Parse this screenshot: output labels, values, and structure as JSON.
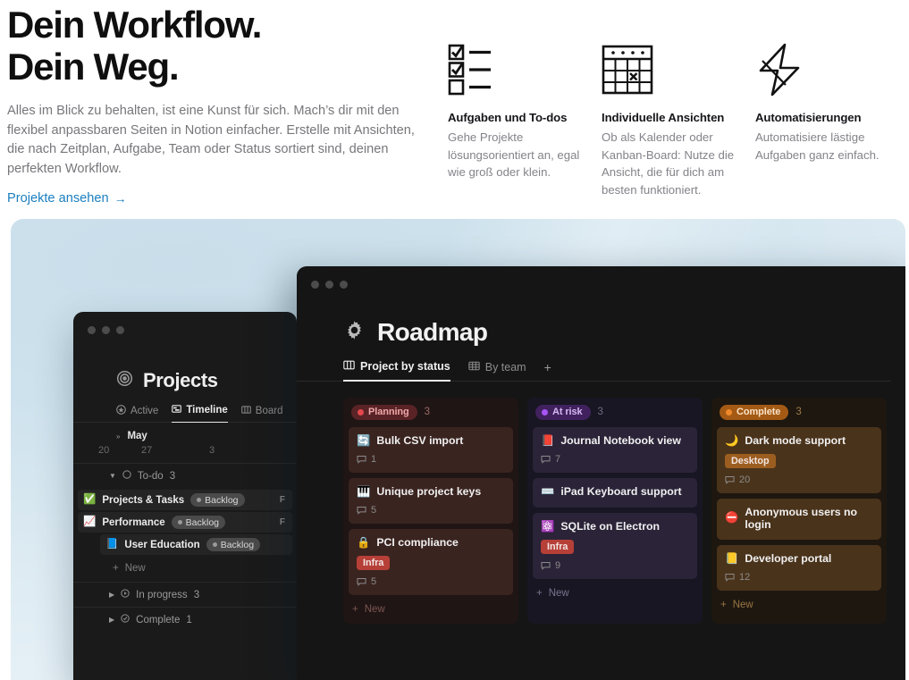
{
  "hero": {
    "title_line1": "Dein Workflow.",
    "title_line2": "Dein Weg.",
    "body": "Alles im Blick zu behalten, ist eine Kunst für sich. Mach’s dir mit den flexibel anpassbaren Seiten in Notion einfacher. Erstelle mit Ansichten, die nach Zeitplan, Aufgabe, Team oder Status sortiert sind, deinen perfekten Workflow.",
    "link_label": "Projekte ansehen",
    "link_arrow": "→",
    "link_color": "#1a7fc1"
  },
  "features": [
    {
      "icon": "checklist-icon",
      "title": "Aufgaben und To-dos",
      "desc": "Gehe Projekte lösungsorientiert an, egal wie groß oder klein."
    },
    {
      "icon": "calendar-icon",
      "title": "Individuelle Ansichten",
      "desc": "Ob als Kalender oder Kanban-Board: Nutze die Ansicht, die für dich am besten funktioniert."
    },
    {
      "icon": "lightning-bolt-icon",
      "title": "Automatisierungen",
      "desc": "Automatisiere lästige Aufgaben ganz einfach."
    }
  ],
  "showcase": {
    "background_color": "#c9deea",
    "projects_window": {
      "title": "Projects",
      "title_icon": "target-icon",
      "tabs": [
        {
          "label": "Active",
          "icon": "star-icon",
          "active": false
        },
        {
          "label": "Timeline",
          "icon": "timeline-icon",
          "active": true
        },
        {
          "label": "Board",
          "icon": "board-icon",
          "active": false
        }
      ],
      "month": "May",
      "dates": [
        "20",
        "27",
        "3"
      ],
      "groups": [
        {
          "name": "To-do",
          "count": "3",
          "expanded": true,
          "icon": "circle-empty-icon",
          "items": [
            {
              "emoji": "✅",
              "name": "Projects & Tasks",
              "chip": "Backlog",
              "flag": "F",
              "indent": false
            },
            {
              "emoji": "📈",
              "name": "Performance",
              "chip": "Backlog",
              "flag": "F",
              "indent": false
            },
            {
              "emoji": "📘",
              "name": "User Education",
              "chip": "Backlog",
              "flag": "",
              "indent": true
            }
          ],
          "new_label": "New"
        },
        {
          "name": "In progress",
          "count": "3",
          "expanded": false,
          "icon": "circle-play-icon",
          "items": [],
          "new_label": ""
        },
        {
          "name": "Complete",
          "count": "1",
          "expanded": false,
          "icon": "circle-check-icon",
          "items": [],
          "new_label": ""
        }
      ]
    },
    "roadmap_window": {
      "title": "Roadmap",
      "title_icon": "gear-icon",
      "tabs": [
        {
          "label": "Project by status",
          "icon": "board-icon",
          "active": true
        },
        {
          "label": "By team",
          "icon": "table-icon",
          "active": false
        }
      ],
      "add_view_label": "+",
      "columns": [
        {
          "status": "Planning",
          "count": "3",
          "dot_color": "#e5484d",
          "badge_bg": "#5a2326",
          "badge_text": "#f0a8aa",
          "col_bg": "#1f1514",
          "card_bg": "#3a2420",
          "count_color": "#9a6a66",
          "new_color": "#7d5651",
          "new_label": "New",
          "cards": [
            {
              "emoji": "🔄",
              "title": "Bulk CSV import",
              "tag": "",
              "tag_bg": "",
              "comments": "1"
            },
            {
              "emoji": "🎹",
              "title": "Unique project keys",
              "tag": "",
              "tag_bg": "",
              "comments": "5"
            },
            {
              "emoji": "🔒",
              "title": "PCI compliance",
              "tag": "Infra",
              "tag_bg": "#b63f38",
              "comments": "5"
            }
          ]
        },
        {
          "status": "At risk",
          "count": "3",
          "dot_color": "#a855f7",
          "badge_bg": "#40215e",
          "badge_text": "#d9b6f5",
          "col_bg": "#181622",
          "card_bg": "#2b2338",
          "count_color": "#6f6780",
          "new_color": "#7a7290",
          "new_label": "New",
          "cards": [
            {
              "emoji": "📕",
              "title": "Journal Notebook view",
              "tag": "",
              "tag_bg": "",
              "comments": "7"
            },
            {
              "emoji": "⌨️",
              "title": "iPad Keyboard support",
              "tag": "",
              "tag_bg": "",
              "comments": ""
            },
            {
              "emoji": "⚛️",
              "title": "SQLite on Electron",
              "tag": "Infra",
              "tag_bg": "#b63f38",
              "comments": "9"
            }
          ]
        },
        {
          "status": "Complete",
          "count": "3",
          "dot_color": "#f0892b",
          "badge_bg": "#a45a14",
          "badge_text": "#fae3c8",
          "col_bg": "#1d1710",
          "card_bg": "#4a331b",
          "count_color": "#a07a45",
          "new_color": "#9a7540",
          "new_label": "New",
          "cards": [
            {
              "emoji": "🌙",
              "title": "Dark mode support",
              "tag": "Desktop",
              "tag_bg": "#9c5e20",
              "comments": "20"
            },
            {
              "emoji": "⛔",
              "title": "Anonymous users no login",
              "tag": "",
              "tag_bg": "",
              "comments": ""
            },
            {
              "emoji": "📒",
              "title": "Developer portal",
              "tag": "",
              "tag_bg": "",
              "comments": "12"
            }
          ]
        }
      ]
    }
  }
}
